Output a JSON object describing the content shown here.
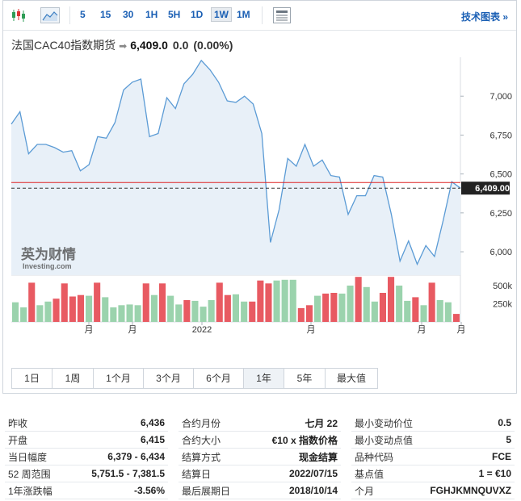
{
  "toolbar": {
    "intervals": [
      "5",
      "15",
      "30",
      "1H",
      "5H",
      "1D",
      "1W",
      "1M"
    ],
    "active_interval": "1W",
    "tech_chart_link": "技术图表 »"
  },
  "quote": {
    "name": "法国CAC40指数期货",
    "price": "6,409.0",
    "change": "0.0",
    "change_pct": "(0.00%)"
  },
  "chart_data": {
    "type": "line",
    "y_ticks": [
      "7,000",
      "6,750",
      "6,500",
      "6,250",
      "6,000"
    ],
    "ylim": [
      5850,
      7250
    ],
    "current_price_label": "6,409.00",
    "reference_line": 6445,
    "current_line": 6409,
    "x_labels": [
      "月",
      "月",
      "2022",
      "月",
      "月",
      "月"
    ],
    "values": [
      6820,
      6900,
      6630,
      6690,
      6690,
      6670,
      6640,
      6650,
      6520,
      6560,
      6740,
      6730,
      6830,
      7040,
      7090,
      7110,
      6740,
      6760,
      6990,
      6920,
      7080,
      7140,
      7230,
      7170,
      7090,
      6970,
      6960,
      7000,
      6950,
      6760,
      6060,
      6270,
      6600,
      6550,
      6690,
      6550,
      6590,
      6490,
      6480,
      6240,
      6360,
      6360,
      6490,
      6480,
      6240,
      5940,
      6070,
      5920,
      6040,
      5970,
      6200,
      6450,
      6409
    ],
    "volume_ticks": [
      "500k",
      "250k"
    ],
    "volume_max": 600000,
    "volumes": [
      270000,
      200000,
      540000,
      230000,
      280000,
      320000,
      530000,
      350000,
      370000,
      360000,
      540000,
      340000,
      200000,
      230000,
      240000,
      230000,
      530000,
      370000,
      530000,
      360000,
      240000,
      300000,
      290000,
      210000,
      300000,
      540000,
      370000,
      380000,
      280000,
      280000,
      570000,
      530000,
      570000,
      580000,
      580000,
      190000,
      230000,
      360000,
      390000,
      400000,
      390000,
      500000,
      620000,
      480000,
      280000,
      400000,
      620000,
      500000,
      290000,
      340000,
      230000,
      540000,
      300000,
      270000,
      110000
    ],
    "volume_up": [
      1,
      1,
      0,
      1,
      1,
      0,
      0,
      0,
      0,
      1,
      0,
      1,
      1,
      1,
      1,
      1,
      0,
      1,
      0,
      1,
      1,
      0,
      1,
      1,
      1,
      0,
      0,
      1,
      1,
      0,
      0,
      0,
      1,
      1,
      1,
      0,
      0,
      1,
      0,
      0,
      1,
      1,
      0,
      1,
      1,
      0,
      0,
      1,
      1,
      0,
      1,
      0,
      1,
      1,
      0
    ]
  },
  "watermark": {
    "cn": "英为财情",
    "en": "Investing.com"
  },
  "ranges": {
    "items": [
      "1日",
      "1周",
      "1个月",
      "3个月",
      "6个月",
      "1年",
      "5年",
      "最大值"
    ],
    "active": "1年"
  },
  "colors": {
    "up": "#9bd3ad",
    "down": "#e85a62",
    "line": "#5b9bd5",
    "area": "#e8f0f8",
    "price_line": "#d22",
    "price_tag": "#222"
  },
  "stats": {
    "col1": [
      {
        "k": "昨收",
        "v": "6,436"
      },
      {
        "k": "开盘",
        "v": "6,415"
      },
      {
        "k": "当日幅度",
        "v": "6,379 - 6,434"
      },
      {
        "k": "52 周范围",
        "v": "5,751.5 - 7,381.5"
      },
      {
        "k": "1年涨跌幅",
        "v": "-3.56%"
      }
    ],
    "col2": [
      {
        "k": "合约月份",
        "v": "七月 22"
      },
      {
        "k": "合约大小",
        "v": "€10 x 指数价格"
      },
      {
        "k": "结算方式",
        "v": "现金结算"
      },
      {
        "k": "结算日",
        "v": "2022/07/15"
      },
      {
        "k": "最后展期日",
        "v": "2018/10/14"
      }
    ],
    "col3": [
      {
        "k": "最小变动价位",
        "v": "0.5"
      },
      {
        "k": "最小变动点值",
        "v": "5"
      },
      {
        "k": "品种代码",
        "v": "FCE"
      },
      {
        "k": "基点值",
        "v": "1 = €10"
      },
      {
        "k": "个月",
        "v": "FGHJKMNQUVXZ"
      }
    ]
  }
}
